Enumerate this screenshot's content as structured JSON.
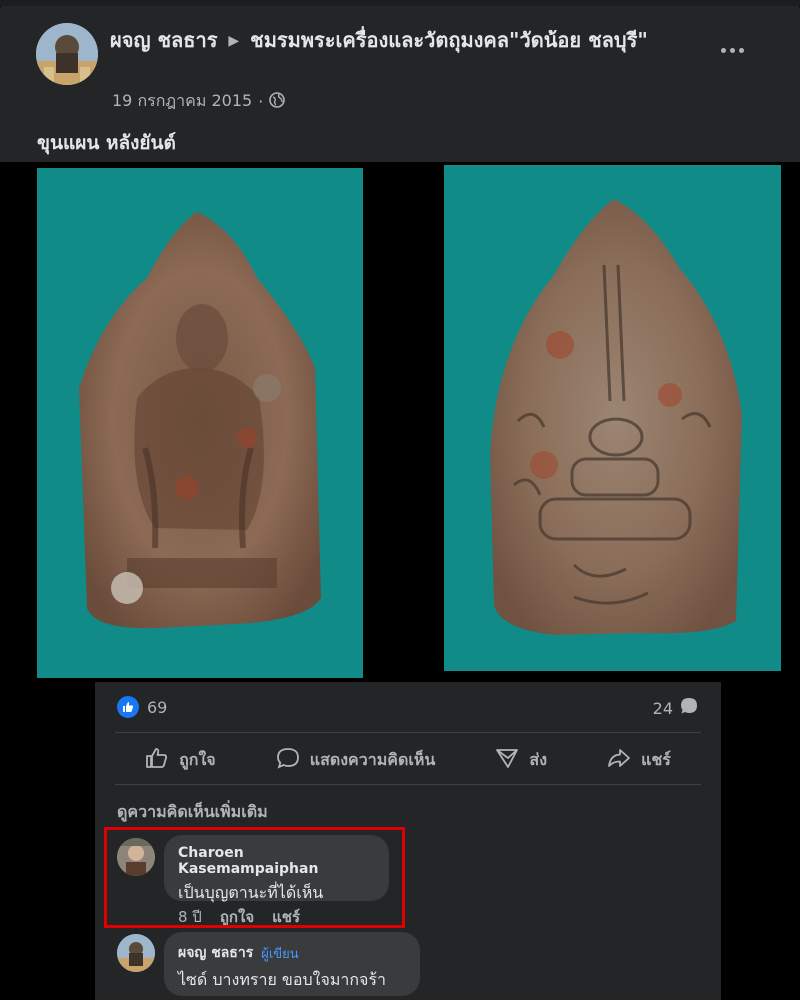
{
  "post": {
    "author": "ผจญ ชลธาร",
    "group": "ชมรมพระเครื่องและวัตถุมงคล\"วัดน้อย ชลบุรี\"",
    "date": "19 กรกฎาคม 2015",
    "separator": "·",
    "caption": "ขุนแผน หลังยันต์",
    "more_icon": "more-horizontal-icon",
    "privacy_icon": "globe-icon"
  },
  "photos": {
    "left_alt": "amulet-front",
    "right_alt": "amulet-back",
    "background_color": "#108b88"
  },
  "stats": {
    "likes": "69",
    "comments": "24"
  },
  "actions": {
    "like": "ถูกใจ",
    "comment": "แสดงความคิดเห็น",
    "send": "ส่ง",
    "share": "แชร์"
  },
  "comments_section": {
    "more_label": "ดูความคิดเห็นเพิ่มเติม",
    "items": [
      {
        "name": "Charoen Kasemampaiphan",
        "text": "เป็นบุญตานะที่ได้เห็น",
        "age": "8 ปี",
        "like": "ถูกใจ",
        "share": "แชร์"
      },
      {
        "name": "ผจญ ชลธาร",
        "badge": "ผู้เขียน",
        "text": "ไซด์ บางทราย ขอบใจมากจร้า"
      }
    ]
  },
  "colors": {
    "accent": "#1877f2",
    "highlight": "#e00000",
    "panel": "#242526",
    "bubble": "#3a3b3c"
  }
}
